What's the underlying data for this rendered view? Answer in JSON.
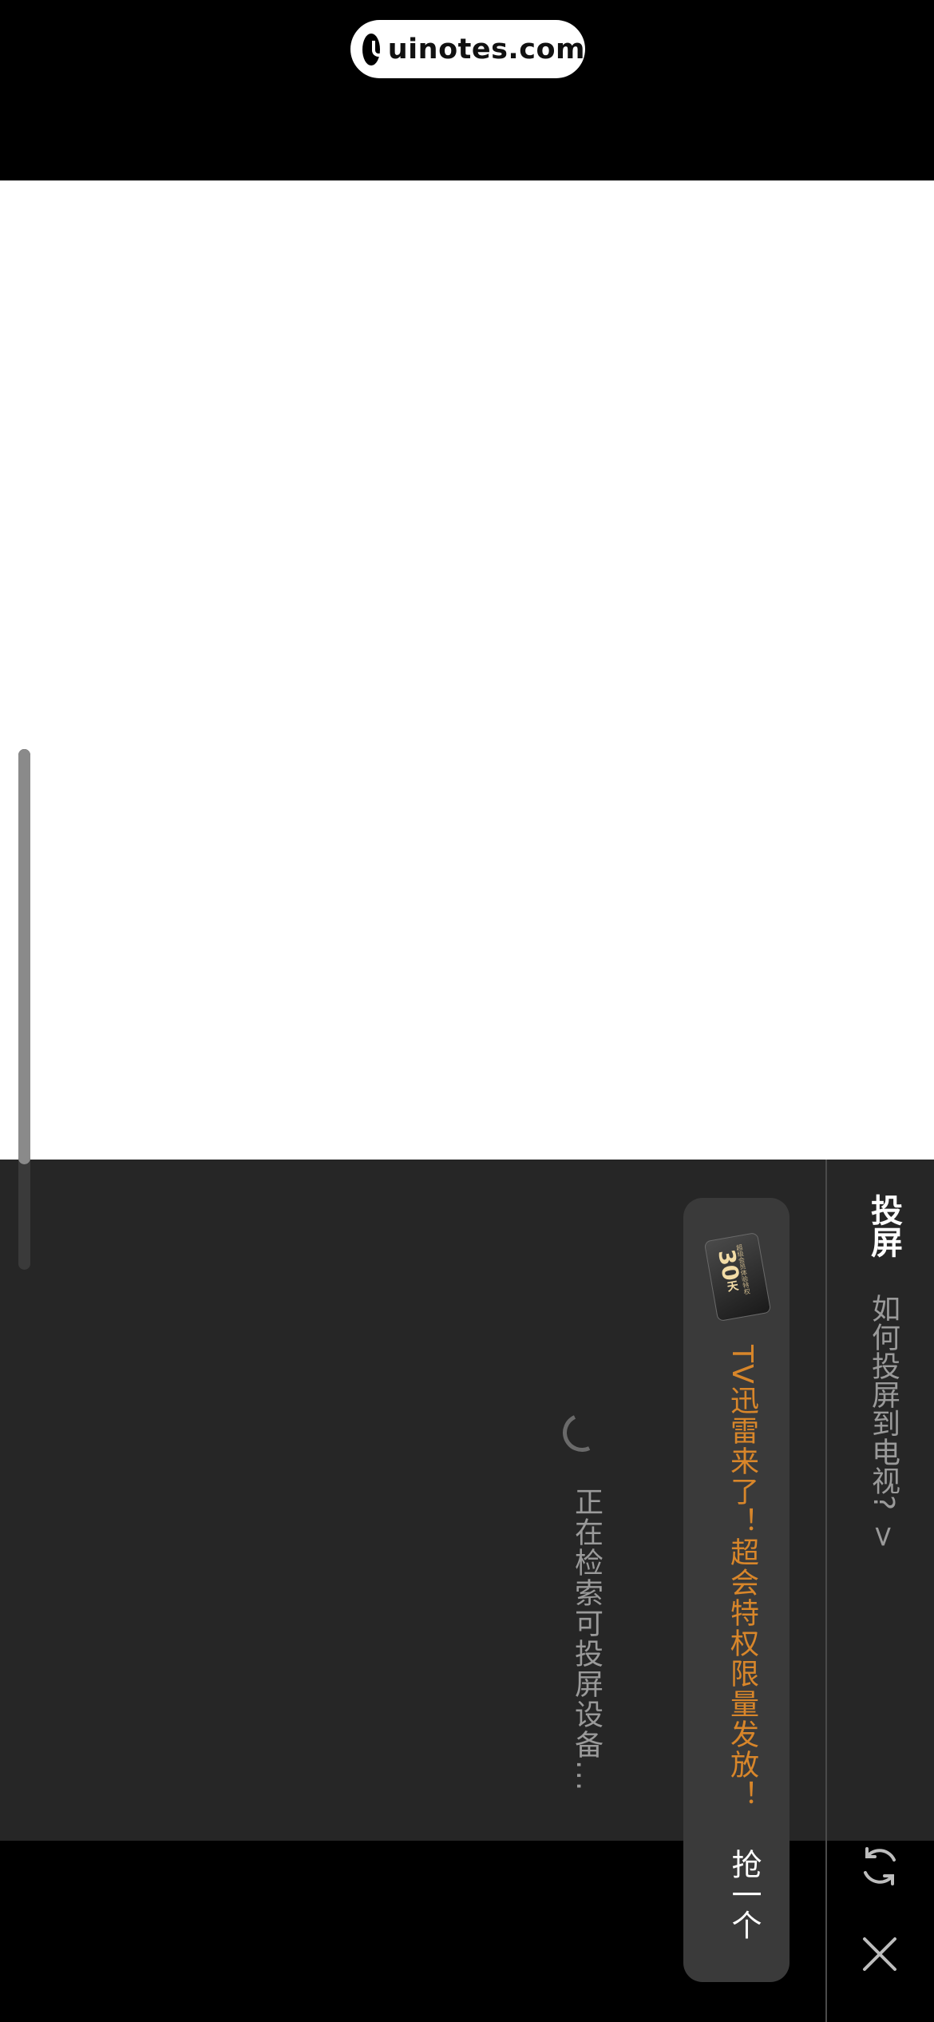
{
  "watermark": {
    "brand": "uinotes.com"
  },
  "cast_panel": {
    "title": "投屏",
    "how_to_link": "如何投屏到电视?",
    "how_to_chevron": ">",
    "promo": {
      "coupon_value": "30",
      "coupon_unit": "天",
      "coupon_fine_print": "超级会员体验特权",
      "text": "TV迅雷来了！超会特权限量发放！",
      "action_label": "抢一个"
    },
    "status_text": "正在检索可投屏设备...",
    "icons": {
      "refresh": "refresh-icon",
      "close": "close-icon"
    }
  },
  "colors": {
    "panel_bg": "#262626",
    "promo_accent": "#d8862a",
    "muted_text": "#9a9a9a"
  }
}
